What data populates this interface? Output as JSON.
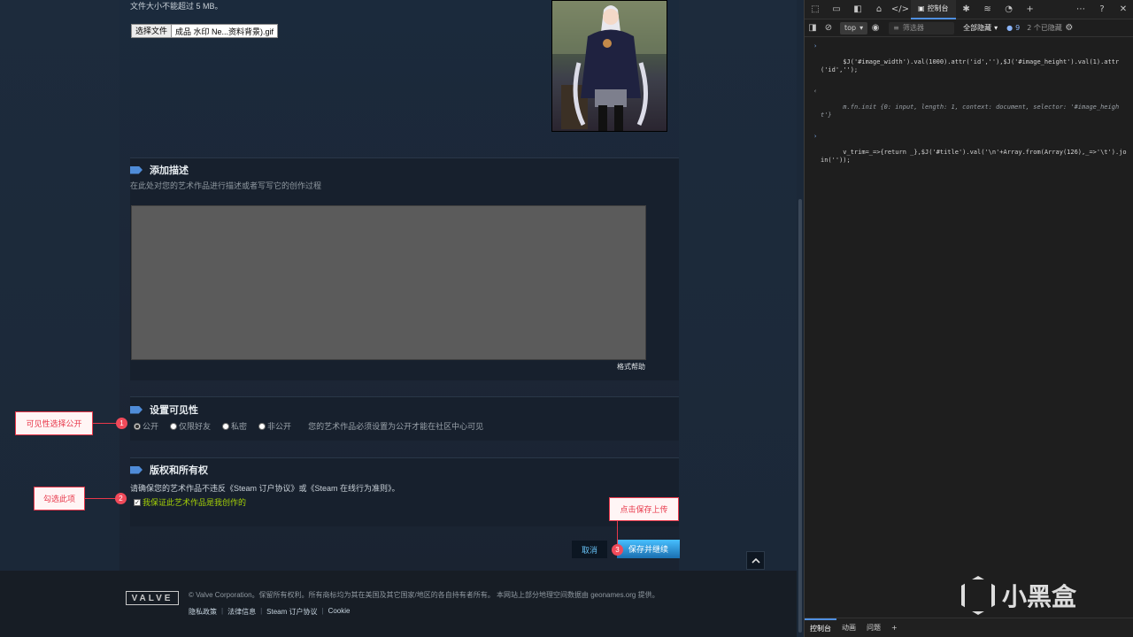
{
  "upload": {
    "size_hint": "文件大小不能超过 5 MB。",
    "choose_file_label": "选择文件",
    "file_name": "成品 水印 Ne...资料背景).gif"
  },
  "description": {
    "title": "添加描述",
    "subtitle": "在此处对您的艺术作品进行描述或者写写它的创作过程",
    "value": "",
    "format_help": "格式帮助"
  },
  "visibility": {
    "title": "设置可见性",
    "options": [
      "公开",
      "仅限好友",
      "私密",
      "非公开"
    ],
    "selected": "公开",
    "note": "您的艺术作品必须设置为公开才能在社区中心可见"
  },
  "ownership": {
    "title": "版权和所有权",
    "text": "请确保您的艺术作品不违反《Steam 订户协议》或《Steam 在线行为准则》。",
    "checkbox_label": "我保证此艺术作品是我创作的",
    "checked": true
  },
  "actions": {
    "cancel": "取消",
    "save": "保存并继续",
    "scroll_top": "^"
  },
  "annotations": [
    {
      "num": "1",
      "label": "可见性选择公开"
    },
    {
      "num": "2",
      "label": "勾选此项"
    },
    {
      "num": "3",
      "label": "点击保存上传"
    }
  ],
  "footer": {
    "logo": "VALVE",
    "copyright": "© Valve Corporation。保留所有权利。所有商标均为其在美国及其它国家/地区的各自持有者所有。 本网站上部分地理空间数据由 geonames.org 提供。",
    "links": [
      "隐私政策",
      "法律信息",
      "Steam 订户协议",
      "Cookie"
    ]
  },
  "devtools": {
    "console_tab": "控制台",
    "context": "top",
    "filter_placeholder": "筛选器",
    "levels": "全部隐藏",
    "issues_count": "9",
    "hidden_count": "2 个已隐藏",
    "lines": [
      {
        "type": "input",
        "text": "$J('#image_width').val(1000).attr('id',''),$J('#image_height').val(1).attr('id','');"
      },
      {
        "type": "output",
        "text": "m.fn.init {0: input, length: 1, context: document, selector: '#image_height'}"
      },
      {
        "type": "input",
        "text": "v_trim=_=>{return _},$J('#title').val('\\n'+Array.from(Array(126),_=>'\\t').join(''));"
      }
    ],
    "bottom_tabs": [
      "控制台",
      "动画",
      "问题"
    ]
  },
  "watermark": "小黑盒"
}
